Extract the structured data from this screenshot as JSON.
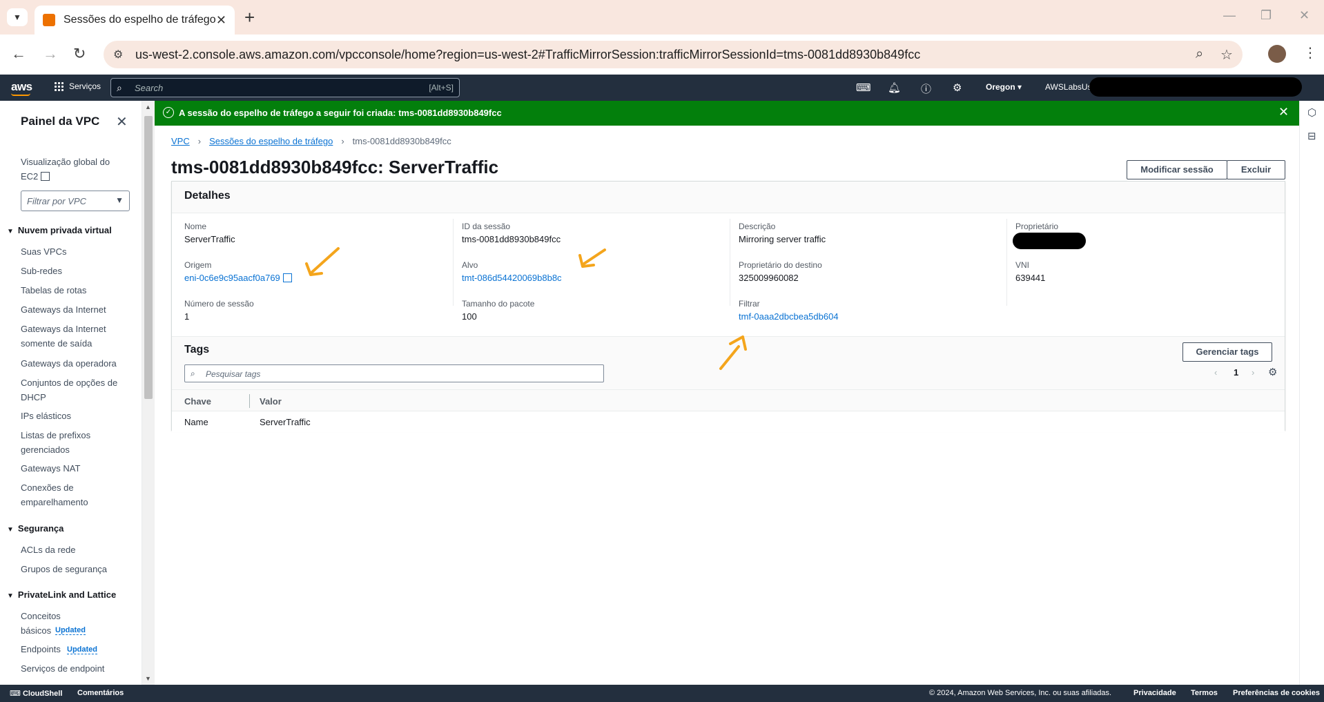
{
  "browser": {
    "tab_title": "Sessões do espelho de tráfego |",
    "url": "us-west-2.console.aws.amazon.com/vpcconsole/home?region=us-west-2#TrafficMirrorSession:trafficMirrorSessionId=tms-0081dd8930b849fcc"
  },
  "aws_header": {
    "logo": "aws",
    "services": "Serviços",
    "search_placeholder": "Search",
    "search_shortcut": "[Alt+S]",
    "region": "Oregon ▾",
    "account": "AWSLabsUse"
  },
  "sidebar": {
    "title": "Painel da VPC",
    "global_view": "Visualização global do EC2",
    "filter_placeholder": "Filtrar por VPC",
    "sections": {
      "vpc": "Nuvem privada virtual",
      "security": "Segurança",
      "privatelink": "PrivateLink and Lattice"
    },
    "vpc_items": [
      "Suas VPCs",
      "Sub-redes",
      "Tabelas de rotas",
      "Gateways da Internet",
      "Gateways da Internet somente de saída",
      "Gateways da operadora",
      "Conjuntos de opções de DHCP",
      "IPs elásticos",
      "Listas de prefixos gerenciados",
      "Gateways NAT",
      "Conexões de emparelhamento"
    ],
    "security_items": [
      "ACLs da rede",
      "Grupos de segurança"
    ],
    "privatelink_items": [
      "Conceitos básicos",
      "Endpoints",
      "Serviços de endpoint"
    ],
    "updated_badge": "Updated"
  },
  "flash": {
    "message": "A sessão do espelho de tráfego a seguir foi criada: tms-0081dd8930b849fcc"
  },
  "breadcrumb": {
    "root": "VPC",
    "parent": "Sessões do espelho de tráfego",
    "current": "tms-0081dd8930b849fcc"
  },
  "page": {
    "title": "tms-0081dd8930b849fcc: ServerTraffic",
    "modify_button": "Modificar sessão",
    "delete_button": "Excluir"
  },
  "details": {
    "heading": "Detalhes",
    "name_label": "Nome",
    "name_value": "ServerTraffic",
    "source_label": "Origem",
    "source_value": "eni-0c6e9c95aacf0a769",
    "session_number_label": "Número de sessão",
    "session_number_value": "1",
    "session_id_label": "ID da sessão",
    "session_id_value": "tms-0081dd8930b849fcc",
    "target_label": "Alvo",
    "target_value": "tmt-086d54420069b8b8c",
    "packet_size_label": "Tamanho do pacote",
    "packet_size_value": "100",
    "description_label": "Descrição",
    "description_value": "Mirroring server traffic",
    "dest_owner_label": "Proprietário do destino",
    "dest_owner_value": "325009960082",
    "filter_label": "Filtrar",
    "filter_value": "tmf-0aaa2dbcbea5db604",
    "owner_label": "Proprietário",
    "vni_label": "VNI",
    "vni_value": "639441"
  },
  "tags": {
    "heading": "Tags",
    "manage_button": "Gerenciar tags",
    "search_placeholder": "Pesquisar tags",
    "page": "1",
    "columns": [
      "Chave",
      "Valor"
    ],
    "rows": [
      {
        "key": "Name",
        "value": "ServerTraffic"
      }
    ]
  },
  "footer": {
    "cloudshell": "CloudShell",
    "feedback": "Comentários",
    "copyright": "© 2024, Amazon Web Services, Inc. ou suas afiliadas.",
    "privacy": "Privacidade",
    "terms": "Termos",
    "cookies": "Preferências de cookies"
  },
  "colors": {
    "success": "#037f0c",
    "link": "#0972d3",
    "header": "#232f3e",
    "annotation_arrow": "#f4a51c"
  }
}
